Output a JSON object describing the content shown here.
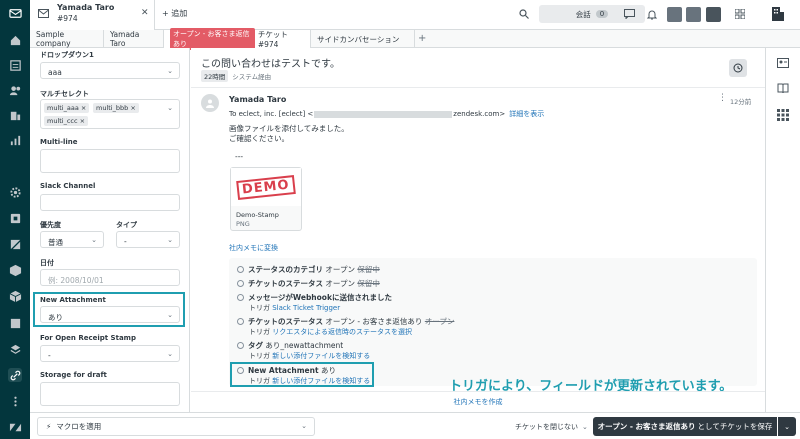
{
  "top_tab": {
    "title": "Yamada Taro",
    "subtitle": "#974",
    "add_label": "追加"
  },
  "conversations": {
    "label": "会話",
    "count": "0"
  },
  "sub_tabs": [
    "Sample company",
    "Yamada Taro",
    "チケット #974",
    "サイドカンバセーション"
  ],
  "status_pill": "オープン - お客さま返信あり",
  "fields": {
    "dropdown1_label": "ドロップダウン1",
    "dropdown1_value": "aaa",
    "multiselect_label": "マルチセレクト",
    "multiselect_chips": [
      "multi_aaa",
      "multi_bbb",
      "multi_ccc"
    ],
    "multiline_label": "Multi-line",
    "slack_label": "Slack Channel",
    "priority_label": "優先度",
    "priority_value": "普通",
    "type_label": "タイプ",
    "type_value": "-",
    "date_label": "日付",
    "date_placeholder": "例: 2008/10/01",
    "new_attachment_label": "New Attachment",
    "new_attachment_value": "あり",
    "open_receipt_label": "For Open Receipt Stamp",
    "open_receipt_value": "-",
    "storage_label": "Storage for draft"
  },
  "conversation": {
    "subject": "この問い合わせはテストです。",
    "duration_badge": "22時間",
    "source": "システム経由",
    "sender": "Yamada Taro",
    "time": "12分前",
    "to_prefix": "To eclect, inc. [eclect] <",
    "to_suffix": "zendesk.com>",
    "show_details": "詳細を表示",
    "body_line1": "画像ファイルを添付してみました。",
    "body_line2": "ご確認ください。",
    "ellipsis": "---",
    "attachment_stamp": "DEMO",
    "attachment_name": "Demo-Stamp",
    "attachment_type": "PNG",
    "to_internal_note": "社内メモに変換"
  },
  "events": [
    {
      "title": "ステータスのカテゴリ",
      "value": "オープン",
      "old": "保留中"
    },
    {
      "title": "チケットのステータス",
      "value": "オープン",
      "old": "保留中"
    },
    {
      "title": "メッセージがWebhookに送信されました",
      "sub_prefix": "トリガ",
      "sub_link": "Slack Ticket Trigger"
    },
    {
      "title": "チケットのステータス",
      "value": "オープン - お客さま返信あり",
      "old": "オープン",
      "sub_prefix": "トリガ",
      "sub_link": "リクエスタによる返信時のステータスを選択"
    },
    {
      "title": "タグ",
      "value": "あり_newattachment",
      "sub_prefix": "トリガ",
      "sub_link": "新しい添付ファイルを検知する"
    },
    {
      "title": "New Attachment",
      "value": "あり",
      "sub_prefix": "トリガ",
      "sub_link": "新しい添付ファイルを検知する"
    }
  ],
  "annotation_text": "トリガにより、フィールドが更新されています。",
  "create_note": "社内メモを作成",
  "bottom": {
    "macro_label": "マクロを適用",
    "close_option": "チケットを閉じない",
    "submit_bold": "オープン - お客さま返信あり",
    "submit_rest": "としてチケットを保存"
  },
  "colors": {
    "nav_bg": "#03363d",
    "highlight": "#1f9eb0",
    "status_red": "#e35b66",
    "link": "#1f73b7",
    "submit_bg": "#2f3941"
  },
  "icons": {
    "left_nav": [
      "zendesk-logo-icon",
      "home-icon",
      "views-icon",
      "customers-icon",
      "organizations-icon",
      "reporting-icon",
      "admin-gear-icon",
      "apps-icon",
      "marketplace-icon",
      "box-icon",
      "cube-icon",
      "window-icon",
      "stack-icon",
      "link-icon",
      "more-icon",
      "zendesk-footer-icon"
    ],
    "right_panel": [
      "user-card-icon",
      "knowledge-icon",
      "apps-grid-icon"
    ]
  }
}
